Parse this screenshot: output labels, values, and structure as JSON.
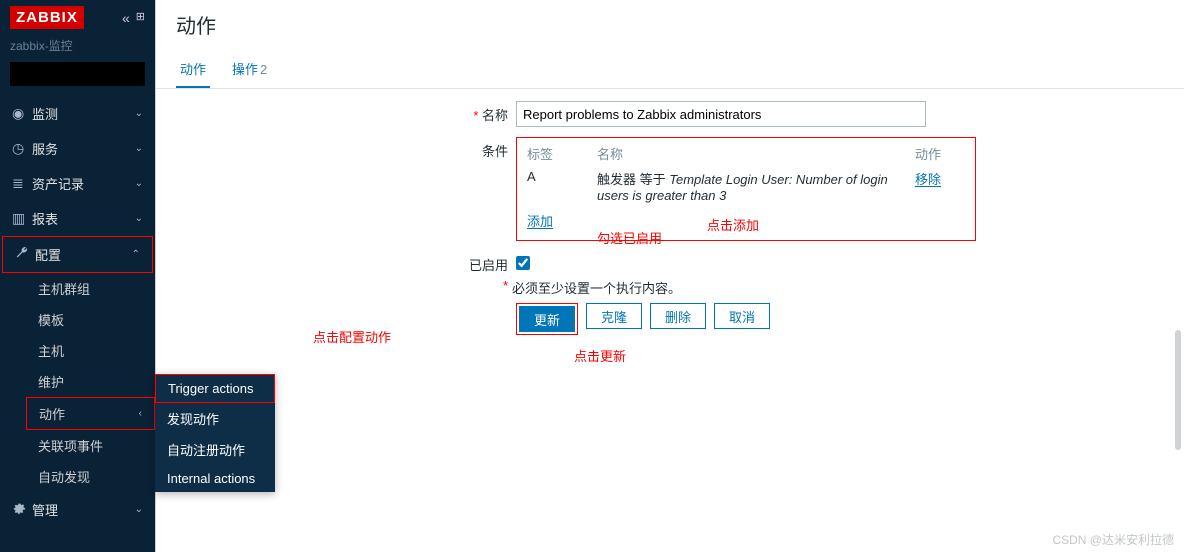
{
  "sidebar": {
    "logo_text": "ZABBIX",
    "server_name": "zabbix-监控",
    "search_placeholder": "",
    "sections": {
      "monitor": "监测",
      "service": "服务",
      "inventory": "资产记录",
      "report": "报表",
      "config": "配置",
      "admin": "管理"
    },
    "config_children": {
      "hostgroups": "主机群组",
      "templates": "模板",
      "hosts": "主机",
      "maintenance": "维护",
      "actions": "动作",
      "correlation": "关联项事件",
      "discovery": "自动发现"
    }
  },
  "flyout": {
    "trigger": "Trigger actions",
    "discovery": "发现动作",
    "autoreg": "自动注册动作",
    "internal": "Internal actions"
  },
  "page": {
    "title": "动作",
    "tabs": {
      "action": "动作",
      "operations_label": "操作",
      "operations_count": "2"
    },
    "form": {
      "name_label": "名称",
      "name_value": "Report problems to Zabbix administrators",
      "cond_label": "条件",
      "cond_head_label": "标签",
      "cond_head_name": "名称",
      "cond_head_action": "动作",
      "cond_a_tag": "A",
      "cond_a_prefix": "触发器 等于 ",
      "cond_a_italic": "Template Login User: Number of login users is greater than 3",
      "cond_a_remove": "移除",
      "add_link": "添加",
      "enabled_label": "已启用",
      "warn_text": "必须至少设置一个执行内容。",
      "buttons": {
        "update": "更新",
        "clone": "克隆",
        "delete": "删除",
        "cancel": "取消"
      }
    }
  },
  "annotations": {
    "config_actions": "点击配置动作",
    "click_update": "点击更新",
    "click_add": "点击添加",
    "check_enabled": "勾选已启用"
  },
  "watermark": "CSDN @达米安利拉德"
}
